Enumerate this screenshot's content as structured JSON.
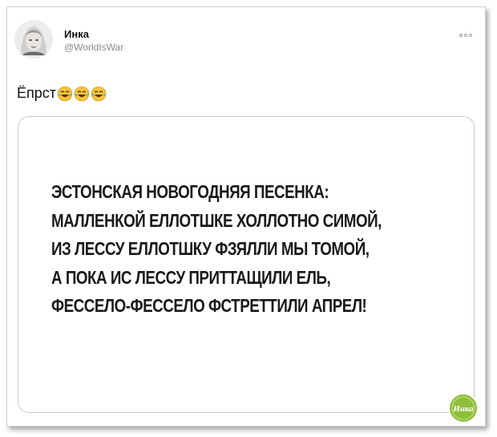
{
  "author": {
    "name": "Инка",
    "handle": "@WorldIsWar"
  },
  "tweet": {
    "text": "Ёпрст",
    "emojis": [
      "face-with-tears-of-joy",
      "face-with-tears-of-joy",
      "face-with-tears-of-joy"
    ]
  },
  "card": {
    "lines": [
      "ЭСТОНСКАЯ НОВОГОДНЯЯ ПЕСЕНКА:",
      "МАЛЛЕНКОЙ ЕЛЛОТШКЕ ХОЛЛОТНО СИМОЙ,",
      "ИЗ ЛЕССУ ЕЛЛОТШКУ ФЗЯЛЛИ МЫ ТОМОЙ,",
      "А ПОКА ИС ЛЕССУ ПРИТТАЩИЛИ ЕЛЬ,",
      "ФЕССЕЛО-ФЕССЕЛО ФСТРЕТТИЛИ АПРЕЛ!"
    ]
  },
  "watermark": {
    "text": "Инка"
  },
  "colors": {
    "text": "#111111",
    "handle": "#8a8a8a",
    "border": "#c9c9c9",
    "logo": "#8fbf3a"
  }
}
